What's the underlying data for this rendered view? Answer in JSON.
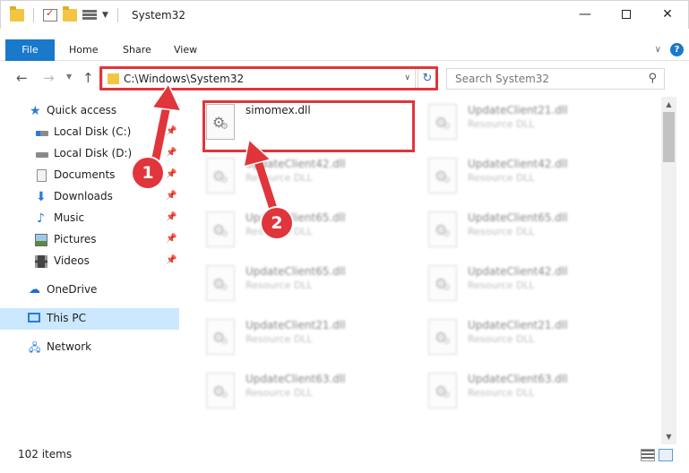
{
  "window": {
    "title": "System32",
    "minimize": "—",
    "close": "✕"
  },
  "ribbon": {
    "tabs": [
      "File",
      "Home",
      "Share",
      "View"
    ],
    "help": "?"
  },
  "nav": {
    "address": "C:\\Windows\\System32",
    "search_placeholder": "Search System32"
  },
  "sidebar": {
    "items": [
      {
        "label": "Quick access",
        "icon": "star-icon",
        "pinned": false
      },
      {
        "label": "Local Disk (C:)",
        "icon": "disk-icon",
        "pinned": true
      },
      {
        "label": "Local Disk (D:)",
        "icon": "disk-icon",
        "pinned": true
      },
      {
        "label": "Documents",
        "icon": "documents-icon",
        "pinned": true
      },
      {
        "label": "Downloads",
        "icon": "downloads-icon",
        "pinned": true
      },
      {
        "label": "Music",
        "icon": "music-icon",
        "pinned": true
      },
      {
        "label": "Pictures",
        "icon": "pictures-icon",
        "pinned": true
      },
      {
        "label": "Videos",
        "icon": "videos-icon",
        "pinned": true
      },
      {
        "label": "OneDrive",
        "icon": "onedrive-icon",
        "pinned": false
      },
      {
        "label": "This PC",
        "icon": "this-pc-icon",
        "pinned": false,
        "selected": true
      },
      {
        "label": "Network",
        "icon": "network-icon",
        "pinned": false
      }
    ]
  },
  "files": [
    {
      "name": "simomex.dll",
      "type": ""
    },
    {
      "name": "UpdateClient21.dll",
      "type": "Resource DLL"
    },
    {
      "name": "UpdateClient42.dll",
      "type": "Resource DLL"
    },
    {
      "name": "UpdateClient42.dll",
      "type": "Resource DLL"
    },
    {
      "name": "UpdateClient65.dll",
      "type": "Resource DLL"
    },
    {
      "name": "UpdateClient65.dll",
      "type": "Resource DLL"
    },
    {
      "name": "UpdateClient65.dll",
      "type": "Resource DLL"
    },
    {
      "name": "UpdateClient42.dll",
      "type": "Resource DLL"
    },
    {
      "name": "UpdateClient21.dll",
      "type": "Resource DLL"
    },
    {
      "name": "UpdateClient21.dll",
      "type": "Resource DLL"
    },
    {
      "name": "UpdateClient63.dll",
      "type": "Resource DLL"
    },
    {
      "name": "UpdateClient63.dll",
      "type": "Resource DLL"
    }
  ],
  "status": {
    "item_count": "102 items"
  },
  "annotations": {
    "step1": "1",
    "step2": "2",
    "color": "#e0353b"
  },
  "colors": {
    "accent": "#1979ca",
    "selection": "#cce8ff"
  }
}
